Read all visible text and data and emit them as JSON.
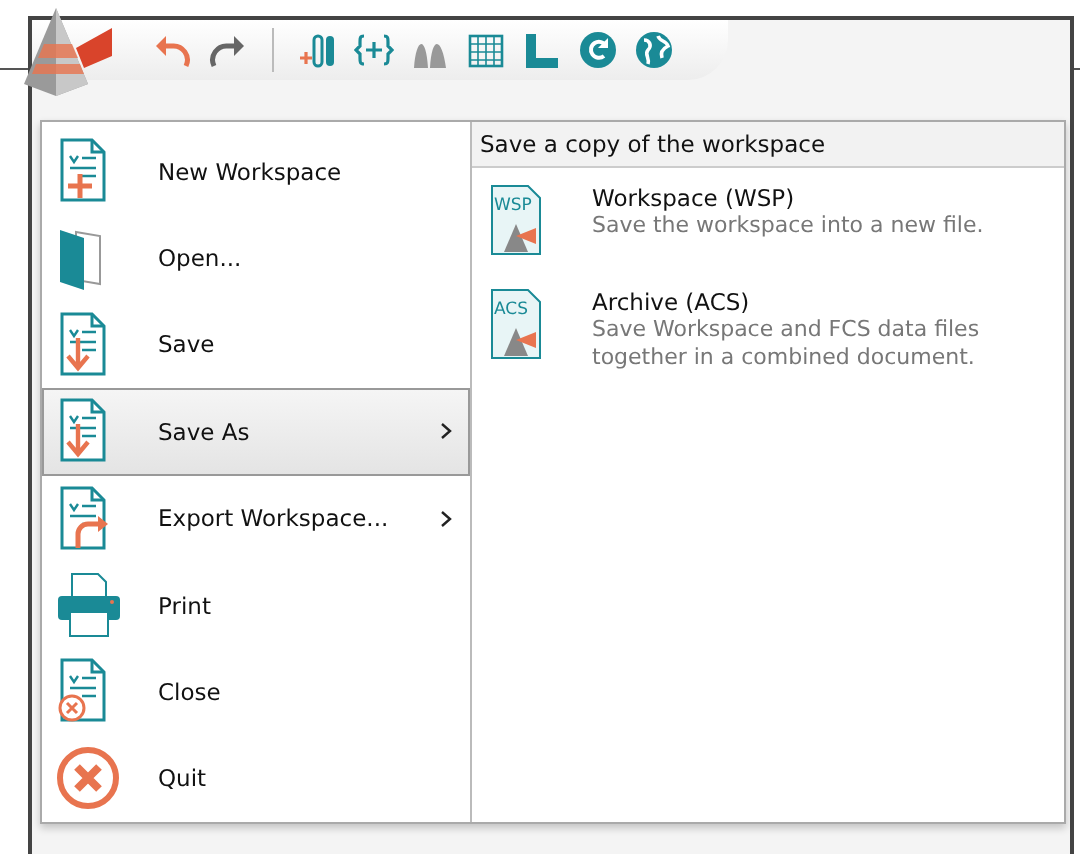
{
  "toolbar": {
    "buttons": [
      {
        "kind": "undo"
      },
      {
        "kind": "redo"
      },
      {
        "kind": "separator"
      },
      {
        "kind": "tubes"
      },
      {
        "kind": "braces"
      },
      {
        "kind": "peaks"
      },
      {
        "kind": "grid"
      },
      {
        "kind": "ruler"
      },
      {
        "kind": "refresh"
      },
      {
        "kind": "globe"
      }
    ]
  },
  "menu": {
    "items": [
      {
        "label": "New Workspace",
        "submenu": false,
        "selected": false
      },
      {
        "label": "Open...",
        "submenu": false,
        "selected": false
      },
      {
        "label": "Save",
        "submenu": false,
        "selected": false
      },
      {
        "label": "Save As",
        "submenu": true,
        "selected": true
      },
      {
        "label": "Export Workspace...",
        "submenu": true,
        "selected": false
      },
      {
        "label": "Print",
        "submenu": false,
        "selected": false
      },
      {
        "label": "Close",
        "submenu": false,
        "selected": false
      },
      {
        "label": "Quit",
        "submenu": false,
        "selected": false
      }
    ]
  },
  "submenu": {
    "header": "Save a copy of the workspace",
    "items": [
      {
        "badge": "WSP",
        "title": "Workspace (WSP)",
        "description": "Save the workspace into a new file."
      },
      {
        "badge": "ACS",
        "title": "Archive (ACS)",
        "description": "Save Workspace and FCS data files together in a combined document."
      }
    ]
  }
}
